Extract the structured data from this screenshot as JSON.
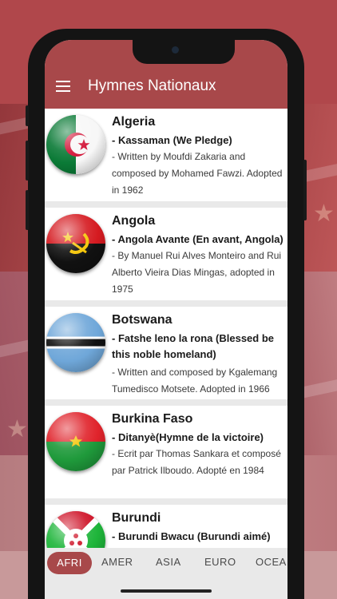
{
  "app": {
    "title": "Hymnes Nationaux"
  },
  "colors": {
    "accent": "#a8484a",
    "background": "#e9e9e9"
  },
  "countries": [
    {
      "name": "Algeria",
      "anthem": "- Kassaman (We Pledge)",
      "description": "- Written by Moufdi Zakaria and composed by Mohamed Fawzi. Adopted in 1962",
      "flag_icon": "algeria-flag-icon"
    },
    {
      "name": "Angola",
      "anthem": "- Angola Avante (En avant, Angola)",
      "description": "- By Manuel Rui Alves Monteiro and Rui Alberto Vieira Dias Mingas, adopted in 1975",
      "flag_icon": "angola-flag-icon"
    },
    {
      "name": "Botswana",
      "anthem": "- Fatshe leno la rona (Blessed be this noble homeland)",
      "description": "- Written and composed by Kgalemang Tumedisco Motsete. Adopted in 1966",
      "flag_icon": "botswana-flag-icon"
    },
    {
      "name": "Burkina Faso",
      "anthem": "- Ditanyè(Hymne de la victoire)",
      "description": "- Ecrit par Thomas Sankara et composé par Patrick Ilboudo. Adopté en 1984",
      "flag_icon": "burkina-faso-flag-icon"
    },
    {
      "name": "Burundi",
      "anthem": "- Burundi Bwacu (Burundi aimé)",
      "description": "",
      "flag_icon": "burundi-flag-icon"
    }
  ],
  "tabs": [
    {
      "label": "AFRI",
      "active": true
    },
    {
      "label": "AMER",
      "active": false
    },
    {
      "label": "ASIA",
      "active": false
    },
    {
      "label": "EURO",
      "active": false
    },
    {
      "label": "OCEA",
      "active": false
    }
  ]
}
